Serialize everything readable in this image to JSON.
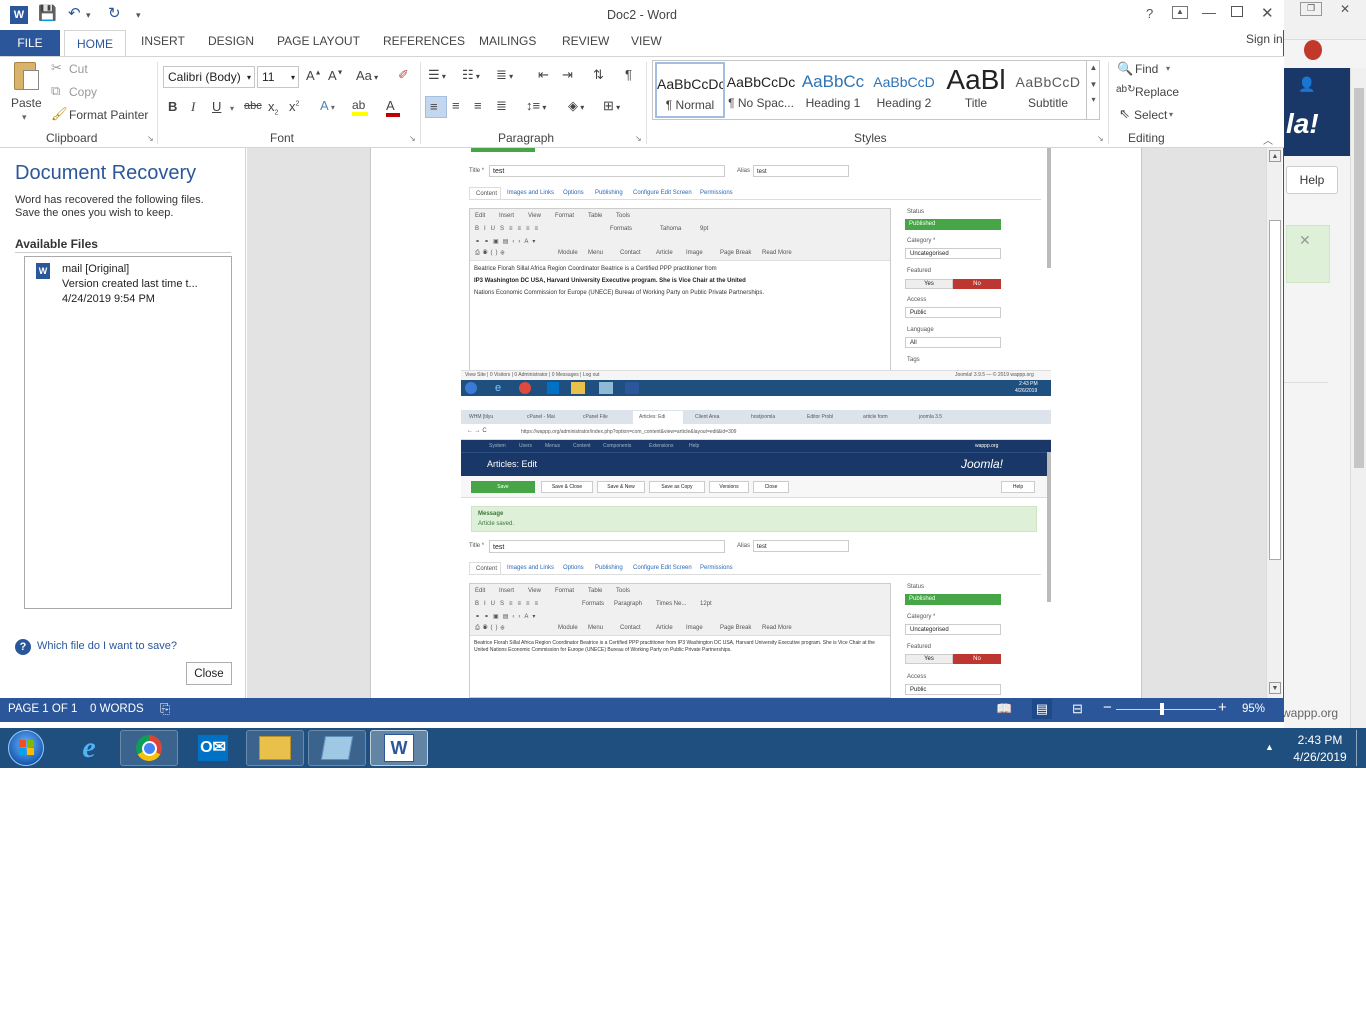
{
  "app": {
    "title": "Doc2 - Word",
    "sign_in": "Sign in",
    "help_q": "?",
    "tabs": [
      "FILE",
      "HOME",
      "INSERT",
      "DESIGN",
      "PAGE LAYOUT",
      "REFERENCES",
      "MAILINGS",
      "REVIEW",
      "VIEW"
    ]
  },
  "ribbon": {
    "clipboard": {
      "paste": "Paste",
      "cut": "Cut",
      "copy": "Copy",
      "format_painter": "Format Painter",
      "label": "Clipboard"
    },
    "font": {
      "name": "Calibri (Body)",
      "size": "11",
      "label": "Font",
      "aa": "Aa"
    },
    "paragraph": {
      "label": "Paragraph"
    },
    "styles": {
      "label": "Styles",
      "items": [
        {
          "sample": "AaBbCcDc",
          "name": "¶ Normal"
        },
        {
          "sample": "AaBbCcDc",
          "name": "¶ No Spac..."
        },
        {
          "sample": "AaBbCc",
          "name": "Heading 1"
        },
        {
          "sample": "AaBbCcD",
          "name": "Heading 2"
        },
        {
          "sample": "AaBl",
          "name": "Title"
        },
        {
          "sample": "AaBbCcD",
          "name": "Subtitle"
        }
      ]
    },
    "editing": {
      "find": "Find",
      "replace": "Replace",
      "select": "Select",
      "label": "Editing"
    }
  },
  "recovery": {
    "title": "Document Recovery",
    "desc": "Word has recovered the following files. Save the ones you wish to keep.",
    "available": "Available Files",
    "file_name": "mail  [Original]",
    "file_version": "Version created last time t...",
    "file_date": "4/24/2019 9:54 PM",
    "which_link": "Which file do I want to save?",
    "close": "Close"
  },
  "status": {
    "page": "PAGE 1 OF 1",
    "words": "0 WORDS",
    "zoom": "95%"
  },
  "embedded": {
    "title_label": "Title *",
    "title_value": "test",
    "alias_label": "Alias",
    "alias_value": "test",
    "tabs": [
      "Content",
      "Images and Links",
      "Options",
      "Publishing",
      "Configure Edit Screen",
      "Permissions"
    ],
    "editor_menu": [
      "Edit",
      "Insert",
      "View",
      "Format",
      "Table",
      "Tools"
    ],
    "body_line1": "Beatrice Florah Sillal Africa Region Coordinator Beatrice is a Certified PPP practitioner from",
    "body_line2": "IP3 Washington DC USA, Harvard University Executive program. She is Vice Chair at the United",
    "body_line3": "Nations Economic Commission for Europe (UNECE) Bureau of Working Party on Public Private Partnerships.",
    "body_b": "Beatrice Florah Sillal Africa Region Coordinator Beatrice is a Certified PPP practitioner from IP3 Washington DC USA, Harvard University Executive program. She is Vice Chair at the United Nations Economic Commission for Europe (UNECE) Bureau of Working Party on Public Private Partnerships.",
    "status_label": "Status",
    "status_value": "Published",
    "category_label": "Category *",
    "category_value": "Uncategorised",
    "featured_label": "Featured",
    "yes": "Yes",
    "no": "No",
    "access_label": "Access",
    "access_value": "Public",
    "language_label": "Language",
    "language_value": "All",
    "tags_label": "Tags",
    "footer_left": "View Site  |  0 Visitors  |  0 Administrator  |  0 Messages  |  Log out",
    "footer_right": "Joomla! 3.9.5 — © 2019 wappp.org",
    "mini_time": "2:43 PM",
    "mini_date": "4/26/2019",
    "browser_tabs": [
      "WHM [tilyu",
      "cPanel - Mai",
      "cPanel File",
      "Articles: Edi",
      "Client Area",
      "hostjoomla",
      "Editor Probl",
      "article form",
      "joomla 3.5"
    ],
    "url": "https://wappp.org/administrator/index.php?option=com_content&view=article&layout=edit&id=309",
    "admin_menu": [
      "System",
      "Users",
      "Menus",
      "Content",
      "Components",
      "Extensions",
      "Help"
    ],
    "site_link": "wappp.org",
    "page_heading": "Articles: Edit",
    "brand": "Joomla!",
    "toolbar": [
      "Save",
      "Save & Close",
      "Save & New",
      "Save as Copy",
      "Versions",
      "Close"
    ],
    "help_btn": "Help",
    "message_title": "Message",
    "message_body": "Article saved.",
    "font_sample_a": "Tahoma",
    "size_a": "9pt",
    "font_sample_b": "Times Ne...",
    "size_b": "12pt",
    "formats": "Formats",
    "paragraph": "Paragraph",
    "btn_row": [
      "Module",
      "Menu",
      "Contact",
      "Article",
      "Image",
      "Page Break",
      "Read More"
    ]
  },
  "background_window": {
    "help": "Help",
    "site": "wappp.org"
  },
  "taskbar": {
    "time": "2:43 PM",
    "date": "4/26/2019"
  },
  "colors": {
    "word_blue": "#2b579a",
    "joomla_navy": "#1a3867",
    "joomla_green": "#46a546",
    "status_red": "#bd362f",
    "taskbar": "#1f4f7e"
  }
}
